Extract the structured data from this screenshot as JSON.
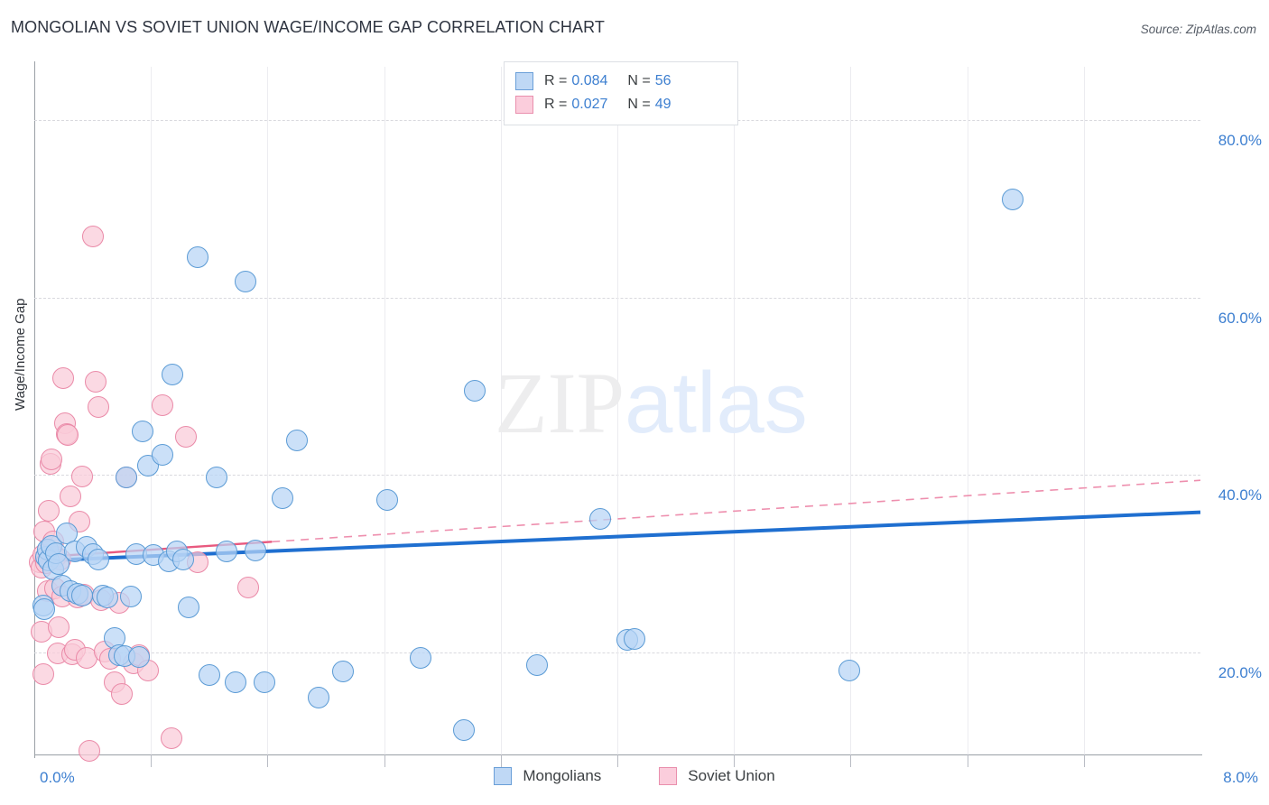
{
  "header": {
    "title": "MONGOLIAN VS SOVIET UNION WAGE/INCOME GAP CORRELATION CHART",
    "source": "Source: ZipAtlas.com"
  },
  "watermark": {
    "part1": "ZIP",
    "part2": "atlas"
  },
  "stats": {
    "rows": [
      {
        "series": "Mongolians",
        "r_label": "R =",
        "r_value": "0.084",
        "n_label": "N =",
        "n_value": "56",
        "color": "#bfd8f5"
      },
      {
        "series": "Soviet Union",
        "r_label": "R =",
        "r_value": "0.027",
        "n_label": "N =",
        "n_value": "49",
        "color": "#fbcddc"
      }
    ]
  },
  "legend": {
    "items": [
      {
        "label": "Mongolians",
        "color": "#bfd8f5"
      },
      {
        "label": "Soviet Union",
        "color": "#fbcddc"
      }
    ]
  },
  "axes": {
    "y_title": "Wage/Income Gap",
    "y_ticks": [
      "80.0%",
      "60.0%",
      "40.0%",
      "20.0%"
    ],
    "x_min_label": "0.0%",
    "x_max_label": "8.0%"
  },
  "chart_data": {
    "type": "scatter",
    "title": "MONGOLIAN VS SOVIET UNION WAGE/INCOME GAP CORRELATION CHART",
    "xlabel": "",
    "ylabel": "Wage/Income Gap",
    "xlim": [
      0.0,
      8.0
    ],
    "ylim": [
      8.5,
      86.0
    ],
    "x_unit": "%",
    "y_unit": "%",
    "grid": "horizontal-dashed",
    "y_gridlines": [
      20.0,
      40.0,
      60.0,
      80.0
    ],
    "legend_position": "bottom-center",
    "series": [
      {
        "name": "Mongolians",
        "color": "#bfd8f5",
        "stroke": "#5b9bd5",
        "r": 0.084,
        "n": 56,
        "trend": {
          "style": "solid",
          "width": 4,
          "x0": 0.0,
          "y0": 30.3,
          "x1": 8.0,
          "y1": 35.8
        },
        "points": [
          [
            0.06,
            25.3
          ],
          [
            0.07,
            24.9
          ],
          [
            0.08,
            30.8
          ],
          [
            0.09,
            31.6
          ],
          [
            0.1,
            30.4
          ],
          [
            0.12,
            32.0
          ],
          [
            0.13,
            29.4
          ],
          [
            0.15,
            31.2
          ],
          [
            0.17,
            30.0
          ],
          [
            0.19,
            27.5
          ],
          [
            0.22,
            33.4
          ],
          [
            0.25,
            26.9
          ],
          [
            0.28,
            31.4
          ],
          [
            0.3,
            26.6
          ],
          [
            0.33,
            26.4
          ],
          [
            0.36,
            31.9
          ],
          [
            0.4,
            31.1
          ],
          [
            0.44,
            30.5
          ],
          [
            0.47,
            26.4
          ],
          [
            0.5,
            26.2
          ],
          [
            0.55,
            21.6
          ],
          [
            0.58,
            19.7
          ],
          [
            0.62,
            19.6
          ],
          [
            0.63,
            39.7
          ],
          [
            0.66,
            26.3
          ],
          [
            0.7,
            31.1
          ],
          [
            0.72,
            19.5
          ],
          [
            0.74,
            44.9
          ],
          [
            0.78,
            41.0
          ],
          [
            0.82,
            31.0
          ],
          [
            0.88,
            42.3
          ],
          [
            0.92,
            30.3
          ],
          [
            0.95,
            51.3
          ],
          [
            0.98,
            31.4
          ],
          [
            1.02,
            30.5
          ],
          [
            1.06,
            25.1
          ],
          [
            1.12,
            64.5
          ],
          [
            1.2,
            17.5
          ],
          [
            1.25,
            39.7
          ],
          [
            1.32,
            31.4
          ],
          [
            1.38,
            16.6
          ],
          [
            1.45,
            61.8
          ],
          [
            1.52,
            31.5
          ],
          [
            1.58,
            16.6
          ],
          [
            1.7,
            37.4
          ],
          [
            1.8,
            43.9
          ],
          [
            1.95,
            14.9
          ],
          [
            2.12,
            17.9
          ],
          [
            2.42,
            37.2
          ],
          [
            2.65,
            19.4
          ],
          [
            2.95,
            11.2
          ],
          [
            3.02,
            49.5
          ],
          [
            3.45,
            18.6
          ],
          [
            3.88,
            35.0
          ],
          [
            4.07,
            21.4
          ],
          [
            4.12,
            21.5
          ],
          [
            5.59,
            18.0
          ],
          [
            6.71,
            71.0
          ]
        ]
      },
      {
        "name": "Soviet Union",
        "color": "#fbcddc",
        "stroke": "#ea8aa8",
        "r": 0.027,
        "n": 49,
        "trend": {
          "style": "dashed-extrapolated",
          "width": 2,
          "x0": 0.0,
          "y0": 30.7,
          "x1": 8.0,
          "y1": 39.4,
          "solid_until": 1.63
        },
        "points": [
          [
            0.04,
            30.2
          ],
          [
            0.05,
            29.6
          ],
          [
            0.05,
            22.3
          ],
          [
            0.06,
            31.0
          ],
          [
            0.06,
            17.6
          ],
          [
            0.07,
            33.6
          ],
          [
            0.08,
            30.1
          ],
          [
            0.09,
            26.9
          ],
          [
            0.1,
            36.0
          ],
          [
            0.11,
            41.3
          ],
          [
            0.12,
            41.8
          ],
          [
            0.13,
            32.5
          ],
          [
            0.14,
            27.2
          ],
          [
            0.15,
            30.8
          ],
          [
            0.16,
            19.9
          ],
          [
            0.17,
            22.8
          ],
          [
            0.18,
            30.5
          ],
          [
            0.19,
            26.3
          ],
          [
            0.2,
            50.9
          ],
          [
            0.21,
            45.8
          ],
          [
            0.22,
            44.6
          ],
          [
            0.23,
            44.5
          ],
          [
            0.25,
            37.6
          ],
          [
            0.26,
            19.8
          ],
          [
            0.28,
            20.3
          ],
          [
            0.3,
            26.2
          ],
          [
            0.31,
            34.7
          ],
          [
            0.33,
            39.8
          ],
          [
            0.34,
            26.5
          ],
          [
            0.36,
            19.4
          ],
          [
            0.38,
            8.9
          ],
          [
            0.4,
            66.9
          ],
          [
            0.42,
            50.5
          ],
          [
            0.44,
            47.7
          ],
          [
            0.46,
            25.9
          ],
          [
            0.48,
            20.1
          ],
          [
            0.52,
            19.3
          ],
          [
            0.55,
            16.6
          ],
          [
            0.58,
            25.6
          ],
          [
            0.6,
            15.3
          ],
          [
            0.63,
            39.7
          ],
          [
            0.68,
            18.8
          ],
          [
            0.72,
            19.7
          ],
          [
            0.78,
            18.0
          ],
          [
            0.88,
            47.9
          ],
          [
            0.94,
            10.3
          ],
          [
            1.04,
            44.3
          ],
          [
            1.12,
            30.2
          ],
          [
            1.47,
            27.3
          ]
        ]
      }
    ]
  }
}
